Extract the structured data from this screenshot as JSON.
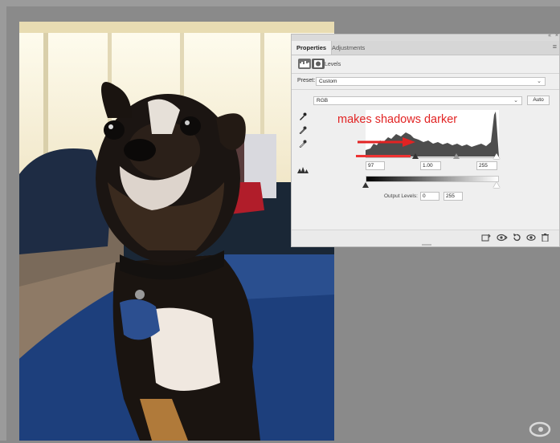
{
  "panel": {
    "tabs": [
      {
        "label": "Properties"
      },
      {
        "label": "Adjustments"
      }
    ],
    "levels_label": "Levels",
    "preset_label": "Preset:",
    "preset_value": "Custom",
    "channel_value": "RGB",
    "auto_label": "Auto",
    "annotation": "makes shadows darker",
    "input_black": "97",
    "input_gamma": "1.00",
    "input_white": "255",
    "output_label": "Output Levels:",
    "output_black": "0",
    "output_white": "255",
    "collapse_icon": "«",
    "close_icon": "×",
    "menu_icon": "≡"
  },
  "icons": {
    "levels": "histogram-icon",
    "mask": "mask-icon",
    "eyedrop_black": "black-eyedropper-icon",
    "eyedrop_gray": "gray-eyedropper-icon",
    "eyedrop_white": "white-eyedropper-icon",
    "clip": "clipping-icon",
    "bottom": [
      "clip-to-layer-icon",
      "view-previous-icon",
      "reset-icon",
      "visibility-icon",
      "delete-icon"
    ]
  },
  "colors": {
    "annotation": "#e22323",
    "canvas": "#8a8a8a",
    "panel": "#efefef"
  }
}
